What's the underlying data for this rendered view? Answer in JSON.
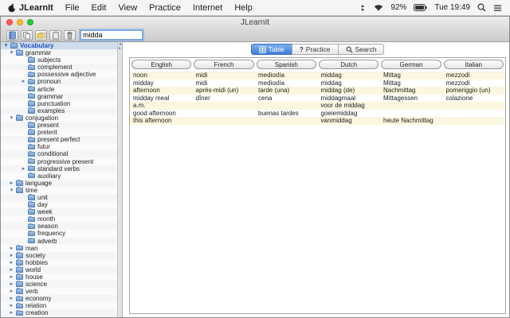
{
  "menubar": {
    "menus": [
      "JLearnIt",
      "File",
      "Edit",
      "View",
      "Practice",
      "Internet",
      "Help"
    ],
    "status": {
      "battery_percent": "92%",
      "clock": "Tue 19:49"
    }
  },
  "window": {
    "title": "JLearnIt",
    "toolbar": {
      "search_value": "midda",
      "buttons": [
        "dictionary",
        "copy",
        "folders",
        "paste",
        "delete"
      ]
    },
    "sidebar": {
      "tree": [
        {
          "label": "Vocabulary",
          "level": 0,
          "expander": "expanded"
        },
        {
          "label": "grammar",
          "level": 1,
          "expander": "expanded"
        },
        {
          "label": "subjects",
          "level": 2,
          "expander": "none"
        },
        {
          "label": "complement",
          "level": 2,
          "expander": "none"
        },
        {
          "label": "possessive adjective",
          "level": 2,
          "expander": "none"
        },
        {
          "label": "pronoun",
          "level": 2,
          "expander": "collapsed"
        },
        {
          "label": "article",
          "level": 2,
          "expander": "none"
        },
        {
          "label": "grammar",
          "level": 2,
          "expander": "none"
        },
        {
          "label": "punctuation",
          "level": 2,
          "expander": "none"
        },
        {
          "label": "examples",
          "level": 2,
          "expander": "none"
        },
        {
          "label": "conjugation",
          "level": 1,
          "expander": "expanded"
        },
        {
          "label": "present",
          "level": 2,
          "expander": "none"
        },
        {
          "label": "preterit",
          "level": 2,
          "expander": "none"
        },
        {
          "label": "present perfect",
          "level": 2,
          "expander": "none"
        },
        {
          "label": "futur",
          "level": 2,
          "expander": "none"
        },
        {
          "label": "conditional",
          "level": 2,
          "expander": "none"
        },
        {
          "label": "progressive present",
          "level": 2,
          "expander": "none"
        },
        {
          "label": "standard verbs",
          "level": 2,
          "expander": "collapsed"
        },
        {
          "label": "auxiliary",
          "level": 2,
          "expander": "none"
        },
        {
          "label": "language",
          "level": 1,
          "expander": "collapsed"
        },
        {
          "label": "time",
          "level": 1,
          "expander": "expanded"
        },
        {
          "label": "unit",
          "level": 2,
          "expander": "none"
        },
        {
          "label": "day",
          "level": 2,
          "expander": "none"
        },
        {
          "label": "week",
          "level": 2,
          "expander": "none"
        },
        {
          "label": "month",
          "level": 2,
          "expander": "none"
        },
        {
          "label": "season",
          "level": 2,
          "expander": "none"
        },
        {
          "label": "frequency",
          "level": 2,
          "expander": "none"
        },
        {
          "label": "adverb",
          "level": 2,
          "expander": "none"
        },
        {
          "label": "man",
          "level": 1,
          "expander": "collapsed"
        },
        {
          "label": "society",
          "level": 1,
          "expander": "collapsed"
        },
        {
          "label": "hobbies",
          "level": 1,
          "expander": "collapsed"
        },
        {
          "label": "world",
          "level": 1,
          "expander": "collapsed"
        },
        {
          "label": "house",
          "level": 1,
          "expander": "collapsed"
        },
        {
          "label": "science",
          "level": 1,
          "expander": "collapsed"
        },
        {
          "label": "verb",
          "level": 1,
          "expander": "collapsed"
        },
        {
          "label": "economy",
          "level": 1,
          "expander": "collapsed"
        },
        {
          "label": "relation",
          "level": 1,
          "expander": "collapsed"
        },
        {
          "label": "creation",
          "level": 1,
          "expander": "collapsed"
        }
      ]
    },
    "main": {
      "tabs": [
        {
          "label": "Table",
          "selected": true
        },
        {
          "label": "Practice",
          "selected": false
        },
        {
          "label": "Search",
          "selected": false
        }
      ],
      "table": {
        "columns": [
          "English",
          "French",
          "Spanish",
          "Dutch",
          "German",
          "Italian"
        ],
        "rows": [
          [
            "noon",
            "midi",
            "mediodía",
            "middag",
            "Mittag",
            "mezzodì"
          ],
          [
            "midday",
            "midi",
            "mediodía",
            "middag",
            "Mittag",
            "mezzodì"
          ],
          [
            "afternoon",
            "après-midi (un)",
            "tarde (una)",
            "middag (de)",
            "Nachmittag",
            "pomeriggio (un)"
          ],
          [
            "midday meal",
            "dîner",
            "cena",
            "middagmaal",
            "Mittagessen",
            "colazione"
          ],
          [
            "a.m.",
            "",
            "",
            "voor de middag",
            "",
            ""
          ],
          [
            "good afternoon",
            "",
            "buenas tardes",
            "goeiemiddag",
            "",
            ""
          ],
          [
            "this afternoon",
            "",
            "",
            "vanmiddag",
            "heute Nachmittag",
            ""
          ]
        ]
      }
    }
  },
  "colors": {
    "accent_blue": "#3e7cd6",
    "selected_row": "#cfdded",
    "alt_row": "#fbf6df",
    "close": "#ff5f57",
    "minimize": "#febc2e",
    "zoom": "#28c840"
  }
}
